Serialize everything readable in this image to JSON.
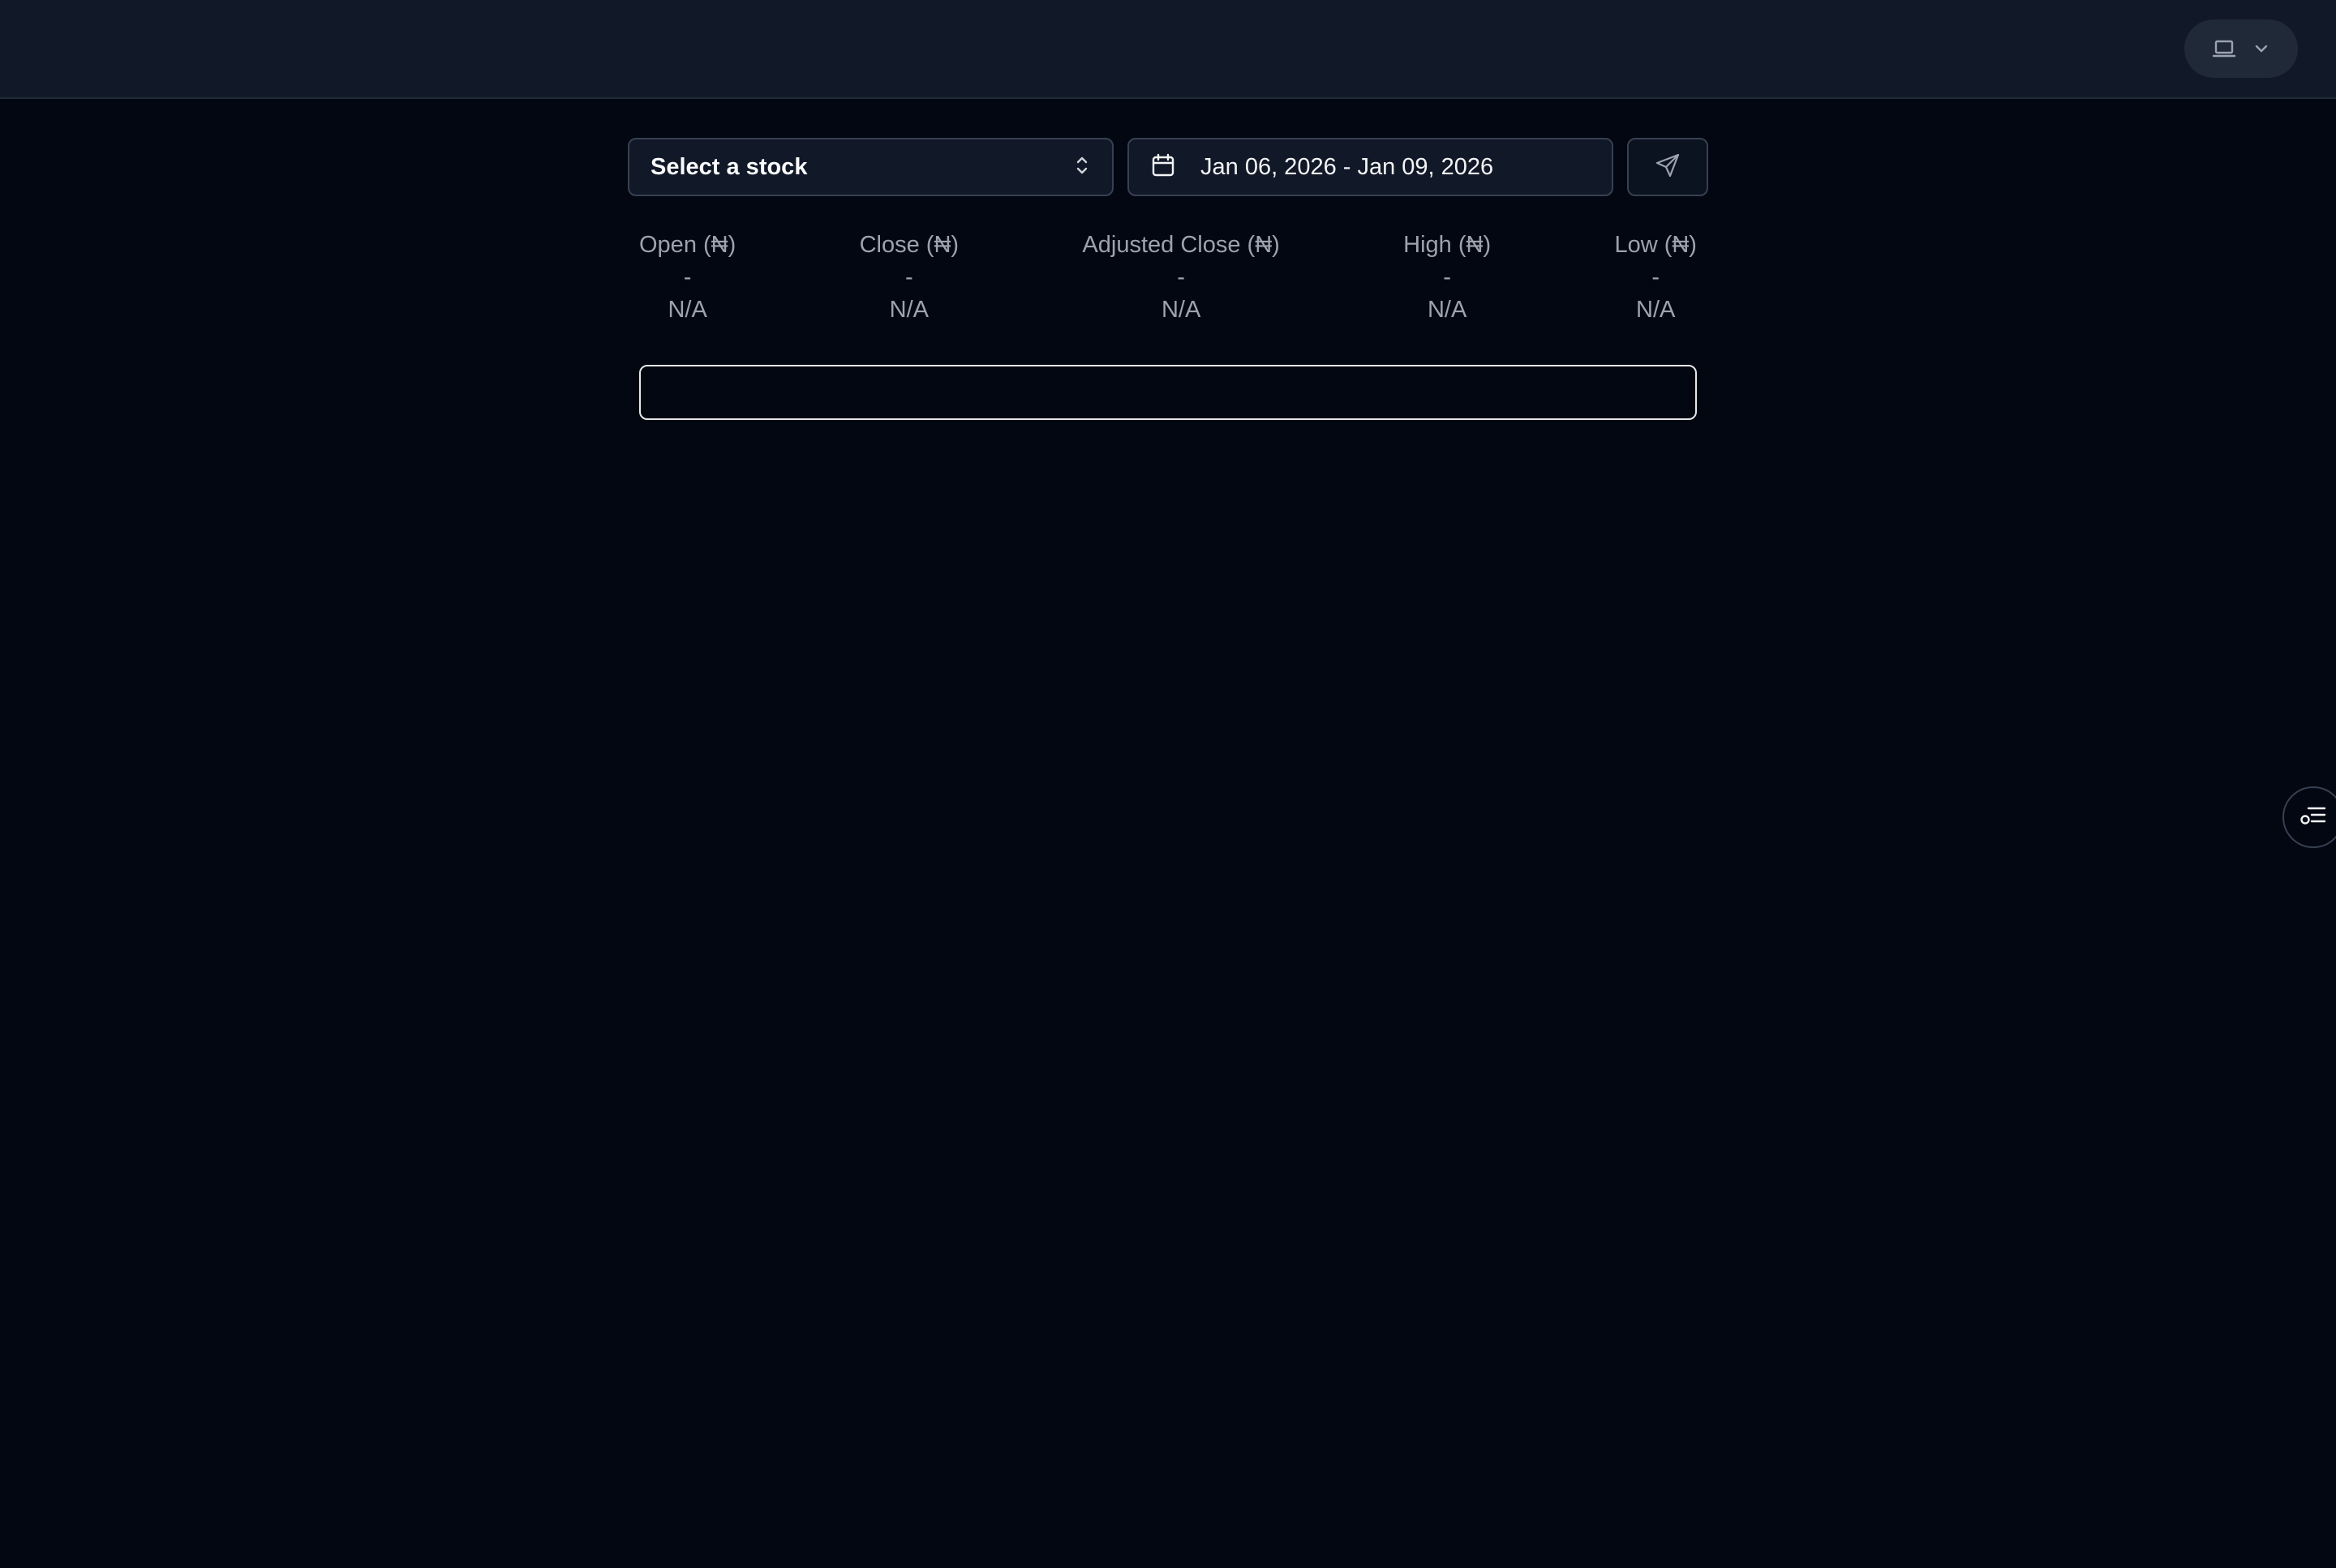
{
  "header": {
    "theme_toggle": {
      "icon": "laptop-icon",
      "dropdown_icon": "chevron-down-icon"
    }
  },
  "controls": {
    "stock_select": {
      "label": "Select a stock",
      "icon": "chevrons-up-down-icon"
    },
    "date_range": {
      "label": "Jan 06, 2026 - Jan 09, 2026",
      "icon": "calendar-icon"
    },
    "send_button": {
      "icon": "send-icon"
    }
  },
  "metrics": [
    {
      "header": "Open (₦)",
      "change": "-",
      "value": "N/A"
    },
    {
      "header": "Close (₦)",
      "change": "-",
      "value": "N/A"
    },
    {
      "header": "Adjusted Close (₦)",
      "change": "-",
      "value": "N/A"
    },
    {
      "header": "High (₦)",
      "change": "-",
      "value": "N/A"
    },
    {
      "header": "Low (₦)",
      "change": "-",
      "value": "N/A"
    }
  ],
  "input": {
    "value": ""
  },
  "side_panel_toggle": {
    "icon": "list-settings-icon"
  },
  "colors": {
    "background": "#030712",
    "header_background": "#111827",
    "border": "#374151",
    "text_primary": "#f9fafb",
    "text_secondary": "#9ca3af"
  }
}
